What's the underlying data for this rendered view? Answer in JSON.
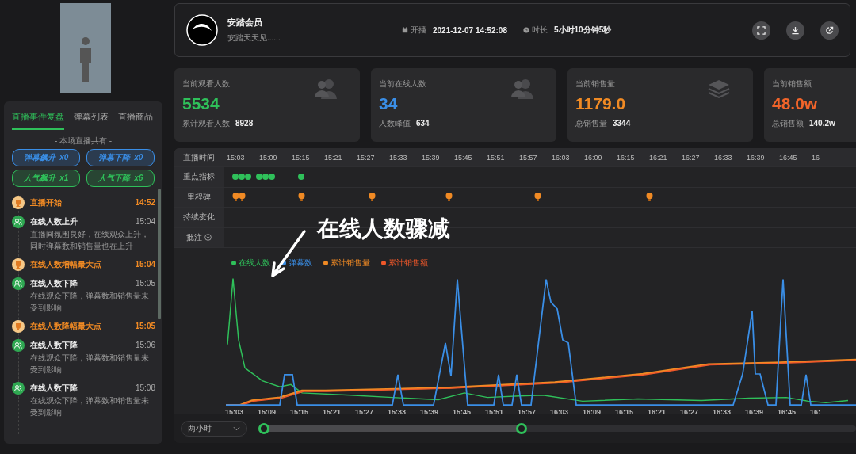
{
  "left_panel": {
    "tabs": [
      {
        "label": "直播事件复盘",
        "selected": true
      },
      {
        "label": "弹幕列表",
        "selected": false
      },
      {
        "label": "直播商品",
        "selected": false
      }
    ],
    "summary_title": "- 本场直播共有 -",
    "badges": [
      {
        "label": "弹幕飙升",
        "count": "x0",
        "color": "#3a8ee6"
      },
      {
        "label": "弹幕下降",
        "count": "x0",
        "color": "#3a8ee6"
      },
      {
        "label": "人气飙升",
        "count": "x1",
        "color": "#2fc05a"
      },
      {
        "label": "人气下降",
        "count": "x6",
        "color": "#2fc05a"
      }
    ],
    "events": [
      {
        "kind": "milestone",
        "title": "直播开始",
        "time": "14:52"
      },
      {
        "kind": "change",
        "title": "在线人数上升",
        "time": "15:04",
        "description": "直播间氛围良好，在线观众上升，同时弹幕数和销售量也在上升"
      },
      {
        "kind": "milestone",
        "title": "在线人数增幅最大点",
        "time": "15:04"
      },
      {
        "kind": "change",
        "title": "在线人数下降",
        "time": "15:05",
        "description": "在线观众下降，弹幕数和销售量未受到影响"
      },
      {
        "kind": "milestone",
        "title": "在线人数降幅最大点",
        "time": "15:05"
      },
      {
        "kind": "change",
        "title": "在线人数下降",
        "time": "15:06",
        "description": "在线观众下降，弹幕数和销售量未受到影响"
      },
      {
        "kind": "change",
        "title": "在线人数下降",
        "time": "15:08",
        "description": "在线观众下降，弹幕数和销售量未受到影响"
      }
    ]
  },
  "header": {
    "name": "安踏会员",
    "subtitle": "安踏天天见......",
    "start_label": "开播",
    "start_time": "2021-12-07 14:52:08",
    "duration_label": "时长",
    "duration": "5小时10分钟5秒"
  },
  "stat_cards": [
    {
      "label": "当前观看人数",
      "value": "5534",
      "color": "#2fc05a",
      "sub_label": "累计观看人数",
      "sub_value": "8928"
    },
    {
      "label": "当前在线人数",
      "value": "34",
      "color": "#3a8ee6",
      "sub_label": "人数峰值",
      "sub_value": "634"
    },
    {
      "label": "当前销售量",
      "value": "1179.0",
      "color": "#f08a24",
      "sub_label": "总销售量",
      "sub_value": "3344"
    },
    {
      "label": "当前销售额",
      "value": "48.0w",
      "color": "#f0642a",
      "sub_label": "总销售额",
      "sub_value": "140.2w"
    }
  ],
  "timeline": {
    "row_labels": [
      "直播时间",
      "重点指标",
      "里程碑",
      "持续变化",
      "批注"
    ],
    "time_labels": [
      "15:03",
      "15:09",
      "15:15",
      "15:21",
      "15:27",
      "15:33",
      "15:39",
      "15:45",
      "15:51",
      "15:57",
      "16:03",
      "16:09",
      "16:15",
      "16:21",
      "16:27",
      "16:33",
      "16:39",
      "16:45",
      "16"
    ]
  },
  "chart": {
    "legend": [
      {
        "label": "在线人数",
        "color": "#2fc05a"
      },
      {
        "label": "弹幕数",
        "color": "#3a8ee6"
      },
      {
        "label": "累计销售量",
        "color": "#f08a24"
      },
      {
        "label": "累计销售额",
        "color": "#f0582a"
      }
    ],
    "x_labels": [
      "15:03",
      "15:09",
      "15:15",
      "15:21",
      "15:27",
      "15:33",
      "15:39",
      "15:45",
      "15:51",
      "15:57",
      "16:03",
      "16:09",
      "16:15",
      "16:21",
      "16:27",
      "16:33",
      "16:39",
      "16:45",
      "16:"
    ],
    "range_select": "两小时",
    "range_slider": {
      "level": 0.44
    }
  },
  "annotation": {
    "text": "在线人数骤减"
  }
}
